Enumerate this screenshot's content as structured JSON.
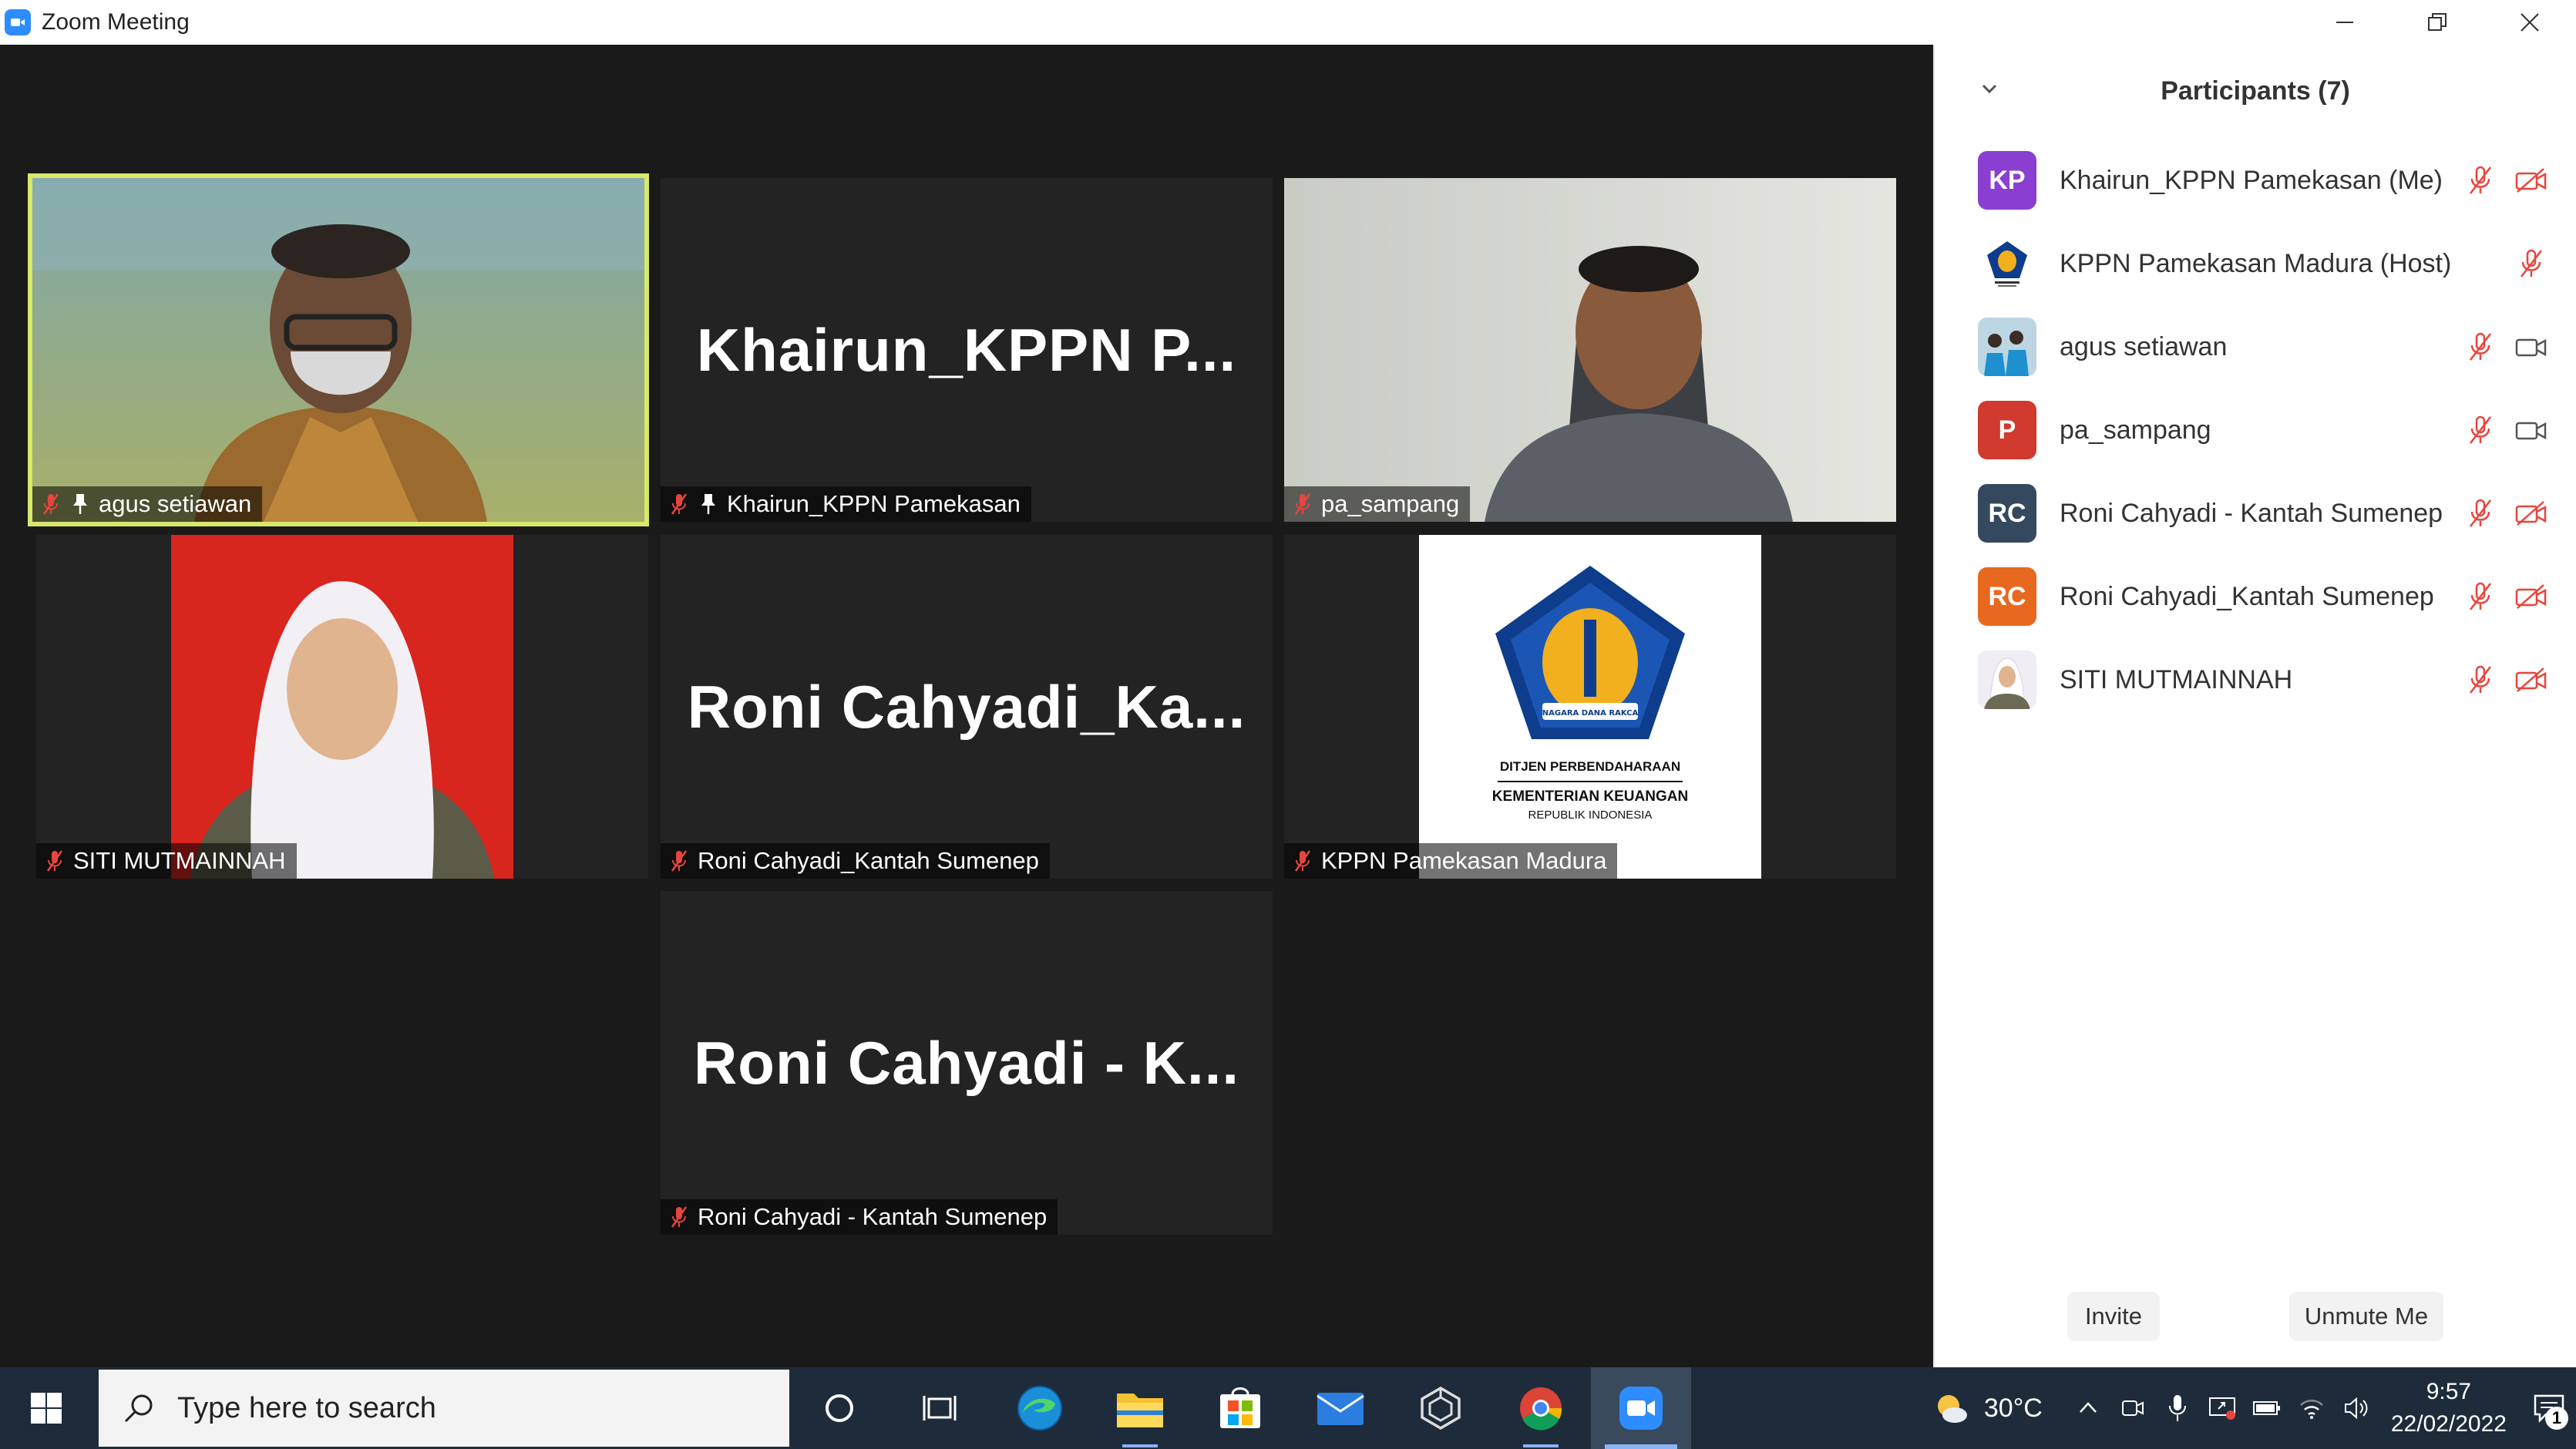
{
  "window": {
    "title": "Zoom Meeting"
  },
  "colors": {
    "zoom_blue": "#2d8cff",
    "active_speaker": "#d8e86a",
    "muted_red": "#e8453c",
    "taskbar": "#1e2b3a"
  },
  "tiles": {
    "agus": {
      "name": "agus setiawan"
    },
    "khairun": {
      "big": "Khairun_KPPN  P...",
      "name": "Khairun_KPPN Pamekasan"
    },
    "pa": {
      "name": "pa_sampang"
    },
    "siti": {
      "name": "SITI MUTMAINNAH"
    },
    "roni1": {
      "big": "Roni  Cahyadi_Ka...",
      "name": "Roni Cahyadi_Kantah Sumenep"
    },
    "kppn": {
      "name": "KPPN Pamekasan Madura",
      "logo_line1": "DITJEN PERBENDAHARAAN",
      "logo_line2": "KEMENTERIAN KEUANGAN",
      "logo_line3": "REPUBLIK INDONESIA",
      "motto": "NAGARA DANA RAKCA"
    },
    "roni2": {
      "big": "Roni  Cahyadi  -  K...",
      "name": "Roni Cahyadi - Kantah Sumenep"
    }
  },
  "panel": {
    "title": "Participants (7)",
    "participants": [
      {
        "initials": "KP",
        "name": "Khairun_KPPN Pamekasan (Me)",
        "color": "#8a3fd1",
        "mic": "muted",
        "video": "off"
      },
      {
        "initials": "",
        "name": "KPPN Pamekasan Madura (Host)",
        "color": "#ffffff",
        "mic": "muted",
        "video": "none"
      },
      {
        "initials": "",
        "name": "agus setiawan",
        "color": "#2a7fb8",
        "mic": "muted",
        "video": "on"
      },
      {
        "initials": "P",
        "name": "pa_sampang",
        "color": "#d03a2f",
        "mic": "muted",
        "video": "on"
      },
      {
        "initials": "RC",
        "name": "Roni Cahyadi - Kantah Sumenep",
        "color": "#34495e",
        "mic": "muted",
        "video": "off"
      },
      {
        "initials": "RC",
        "name": "Roni Cahyadi_Kantah Sumenep",
        "color": "#e8681f",
        "mic": "muted",
        "video": "off"
      },
      {
        "initials": "",
        "name": "SITI MUTMAINNAH",
        "color": "#e9e4f0",
        "mic": "muted",
        "video": "off"
      }
    ],
    "invite": "Invite",
    "unmute": "Unmute Me"
  },
  "taskbar": {
    "search_placeholder": "Type here to search",
    "temperature": "30°C",
    "time": "9:57",
    "date": "22/02/2022",
    "notifications": "1"
  }
}
